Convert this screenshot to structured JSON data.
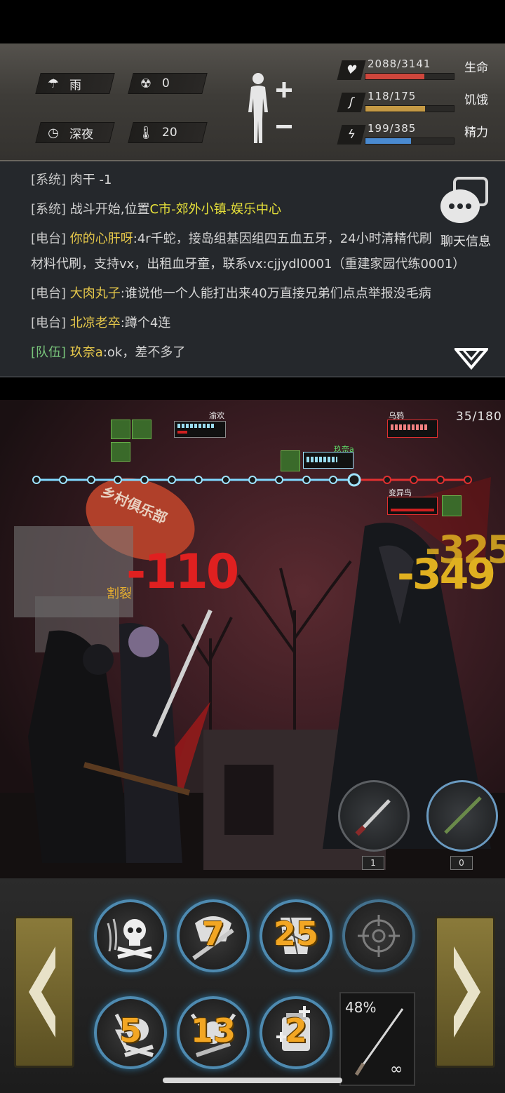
{
  "status": {
    "weather": {
      "icon": "rain-icon",
      "label": "雨"
    },
    "radiation": {
      "icon": "radiation-icon",
      "value": "0"
    },
    "time": {
      "icon": "clock-icon",
      "label": "深夜"
    },
    "temperature": {
      "icon": "thermometer-icon",
      "value": "20"
    },
    "bars": [
      {
        "name": "生命",
        "value_text": "2088/3141",
        "fraction": 0.665,
        "color": "#d0463c",
        "icon": "heart-icon"
      },
      {
        "name": "饥饿",
        "value_text": "118/175",
        "fraction": 0.674,
        "color": "#c59a45",
        "icon": "stomach-icon"
      },
      {
        "name": "精力",
        "value_text": "199/385",
        "fraction": 0.517,
        "color": "#4a8ad0",
        "icon": "energy-icon"
      }
    ]
  },
  "chat": {
    "lines": [
      {
        "channel": "[系统]",
        "text": " 肉干 -1"
      },
      {
        "channel": "[系统]",
        "text": " 战斗开始,位置",
        "highlight": "C市-郊外小镇-娱乐中心"
      },
      {
        "channel": "[电台]",
        "name": " 你的心肝呀",
        "text": ":4r千蛇，接岛组基因组四五血五牙，24小时清精代刷"
      },
      {
        "channel": "",
        "text": "材料代刷，支持vx，出租血牙童，联系vx:cjjydl0001（重建家园代练0001）"
      },
      {
        "channel": "[电台]",
        "name": " 大肉丸子",
        "text": ":谁说他一个人能打出来40万直接兄弟们点点举报没毛病"
      },
      {
        "channel": "[电台]",
        "name": " 北凉老卒",
        "text": ":蹲个4连"
      },
      {
        "channel": "[队伍]",
        "name": " 玖奈a",
        "text": ":ok，差不多了"
      }
    ],
    "chat_info_label": "聊天信息"
  },
  "battle": {
    "wave": "35/180",
    "units": {
      "ally1": "渝欢",
      "ally2": "玖奈a",
      "enemy1": "乌鸦",
      "enemy2": "变异鸟"
    },
    "damage": {
      "left": "-110",
      "right_back": "-325",
      "right_front": "-349",
      "status_label": "割裂"
    },
    "sign_text": "乡村俱乐部",
    "weapon_slots": [
      "1",
      "0"
    ]
  },
  "skills": {
    "row1": [
      {
        "icon": "poison-skull-icon",
        "count": ""
      },
      {
        "icon": "bull-skill-icon",
        "count": "7"
      },
      {
        "icon": "shatter-skill-icon",
        "count": "25"
      },
      {
        "icon": "crosshair-icon",
        "count": ""
      }
    ],
    "row2": [
      {
        "icon": "lightning-skull-icon",
        "count": "5"
      },
      {
        "icon": "horned-skull-icon",
        "count": "13"
      },
      {
        "icon": "medkit-icon",
        "count": "2"
      }
    ],
    "weapon": {
      "durability": "48%",
      "ammo": "∞"
    }
  }
}
